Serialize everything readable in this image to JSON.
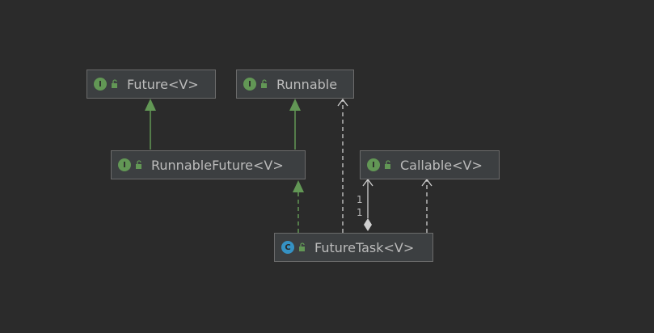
{
  "nodes": {
    "future": {
      "label": "Future<V>",
      "kind": "I"
    },
    "runnable": {
      "label": "Runnable",
      "kind": "I"
    },
    "runnable_future": {
      "label": "RunnableFuture<V>",
      "kind": "I"
    },
    "callable": {
      "label": "Callable<V>",
      "kind": "I"
    },
    "future_task": {
      "label": "FutureTask<V>",
      "kind": "C"
    }
  },
  "multiplicity": {
    "top": "1",
    "bottom": "1"
  },
  "colors": {
    "background": "#2b2b2b",
    "node_fill": "#3c3f41",
    "node_border": "#6b6b6b",
    "text": "#bbbbbb",
    "interface_badge": "#629755",
    "class_badge": "#3592c4",
    "extends_arrow": "#629755",
    "implements_arrow": "#cfcfcf"
  },
  "icons": {
    "interface_badge": "interface-icon",
    "class_badge": "class-icon",
    "visibility": "unlock-icon"
  },
  "edges": [
    {
      "from": "runnable_future",
      "to": "future",
      "type": "extends"
    },
    {
      "from": "runnable_future",
      "to": "runnable",
      "type": "extends"
    },
    {
      "from": "future_task",
      "to": "runnable_future",
      "type": "implements"
    },
    {
      "from": "future_task",
      "to": "runnable",
      "type": "dependency"
    },
    {
      "from": "future_task",
      "to": "callable",
      "type": "dependency"
    },
    {
      "from": "future_task",
      "to": "callable",
      "type": "aggregation"
    }
  ]
}
